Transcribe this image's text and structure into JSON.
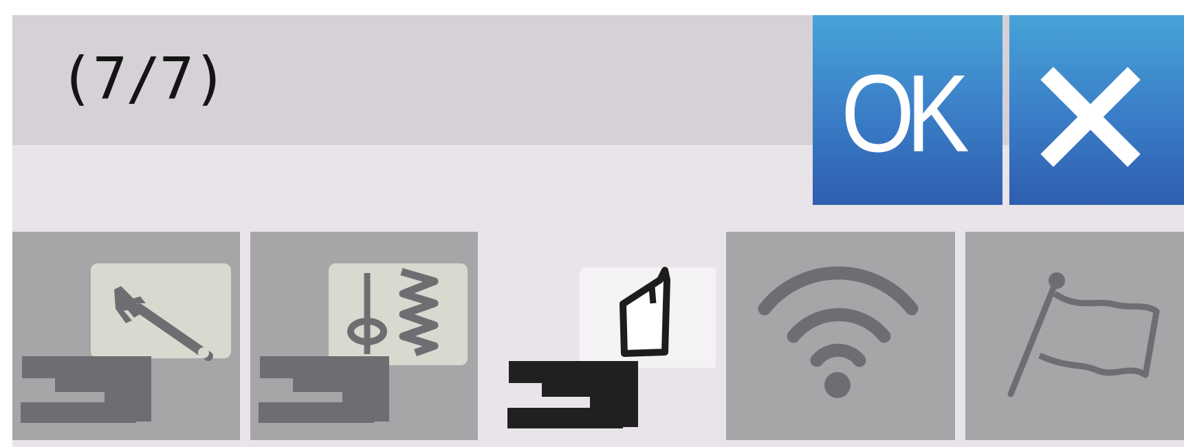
{
  "header": {
    "page_indicator": "(7/7)"
  },
  "buttons": {
    "ok_label": "OK",
    "close_icon": "close-x-icon"
  },
  "tabs": [
    {
      "name": "machine-maintenance",
      "icon": "sewing-machine-wrench-icon",
      "state": "inactive"
    },
    {
      "name": "stitch-settings",
      "icon": "sewing-machine-needle-stitch-icon",
      "state": "inactive"
    },
    {
      "name": "embroidery-frame",
      "icon": "sewing-machine-frame-icon",
      "state": "selected"
    },
    {
      "name": "wireless-lan",
      "icon": "wifi-icon",
      "state": "inactive"
    },
    {
      "name": "language",
      "icon": "flag-icon",
      "state": "inactive"
    }
  ],
  "colors": {
    "panel_background": "#e9e4ea",
    "header_background": "#d5d1d6",
    "button_gradient_top": "#48a3d7",
    "button_gradient_bottom": "#2f5eaf",
    "inactive_tab": "#a6a6a8",
    "inactive_icon": "#6e6e72",
    "active_icon": "#202020"
  }
}
